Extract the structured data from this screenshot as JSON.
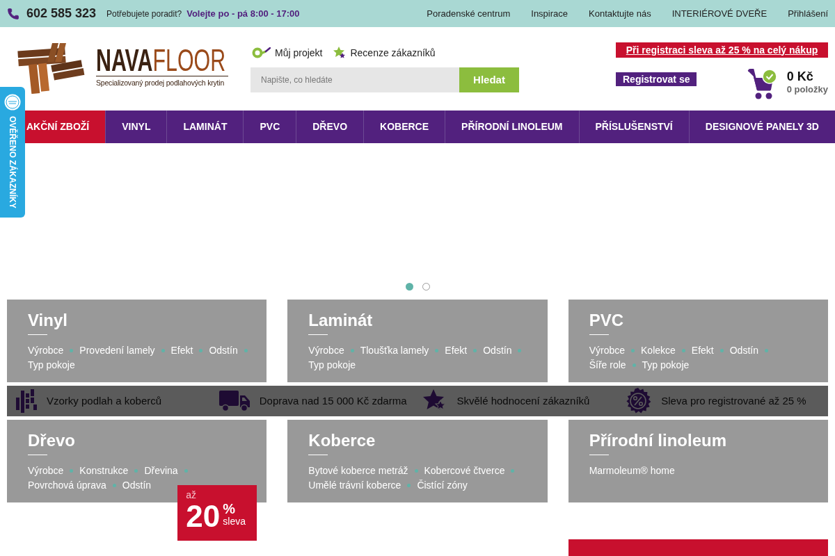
{
  "top_bar": {
    "phone": "602 585 323",
    "help_label": "Potřebujete poradit?",
    "hours": "Volejte po - pá 8:00 - 17:00",
    "links": [
      "Poradenské centrum",
      "Inspirace",
      "Kontaktujte nás",
      "INTERIÉROVÉ DVEŘE",
      "Přihlášení"
    ]
  },
  "header": {
    "logo": {
      "brand_dark": "NAVA",
      "brand_light": "FLOOR",
      "tagline": "Specializovaný prodej podlahových krytin"
    },
    "quick_links": [
      {
        "kind": "project",
        "label": "Můj projekt"
      },
      {
        "kind": "reviews",
        "label": "Recenze zákazníků"
      }
    ],
    "search": {
      "placeholder": "Napište, co hledáte",
      "button": "Hledat"
    },
    "promo_banner": "Při registraci sleva až 25 % na celý nákup",
    "register_button": "Registrovat se",
    "cart": {
      "total": "0 Kč",
      "items": "0 položky"
    }
  },
  "verified_badge": {
    "label": "OVĚŘENO ZÁKAZNÍKY"
  },
  "nav": [
    {
      "label": "AKČNÍ ZBOŽÍ",
      "highlighted": true
    },
    {
      "label": "VINYL",
      "highlighted": false
    },
    {
      "label": "LAMINÁT",
      "highlighted": false
    },
    {
      "label": "PVC",
      "highlighted": false
    },
    {
      "label": "DŘEVO",
      "highlighted": false
    },
    {
      "label": "KOBERCE",
      "highlighted": false
    },
    {
      "label": "PŘÍRODNÍ LINOLEUM",
      "highlighted": false
    },
    {
      "label": "PŘÍSLUŠENSTVÍ",
      "highlighted": false
    },
    {
      "label": "DESIGNOVÉ PANELY 3D",
      "highlighted": false
    }
  ],
  "hero_slider": {
    "dots": [
      {
        "selected": true
      },
      {
        "selected": false
      }
    ]
  },
  "categories_row_1": [
    {
      "title": "Vinyl",
      "links": [
        "Výrobce",
        "Provedení lamely",
        "Efekt",
        "Odstín",
        "Typ pokoje"
      ]
    },
    {
      "title": "Laminát",
      "links": [
        "Výrobce",
        "Tloušťka lamely",
        "Efekt",
        "Odstín",
        "Typ pokoje"
      ]
    },
    {
      "title": "PVC",
      "links": [
        "Výrobce",
        "Kolekce",
        "Efekt",
        "Odstín",
        "Šíře role",
        "Typ pokoje"
      ]
    }
  ],
  "usp_band": [
    {
      "kind": "samples",
      "label": "Vzorky podlah a koberců"
    },
    {
      "kind": "delivery",
      "label": "Doprava nad 15 000 Kč zdarma"
    },
    {
      "kind": "rating",
      "label": "Skvělé hodnocení zákazníků"
    },
    {
      "kind": "discount",
      "label": "Sleva pro registrované až 25 %"
    }
  ],
  "categories_row_2": [
    {
      "title": "Dřevo",
      "links": [
        "Výrobce",
        "Konstrukce",
        "Dřevina",
        "Povrchová úprava",
        "Odstín"
      ]
    },
    {
      "title": "Koberce",
      "links": [
        "Bytové koberce metráž",
        "Kobercové čtverce",
        "Umělé trávní koberce",
        "Čistící zóny"
      ]
    },
    {
      "title": "Přírodní linoleum",
      "links": [
        "Marmoleum® home"
      ]
    }
  ],
  "discount_badge": {
    "prefix": "až",
    "value": "20",
    "unit": "%",
    "label": "sleva"
  }
}
